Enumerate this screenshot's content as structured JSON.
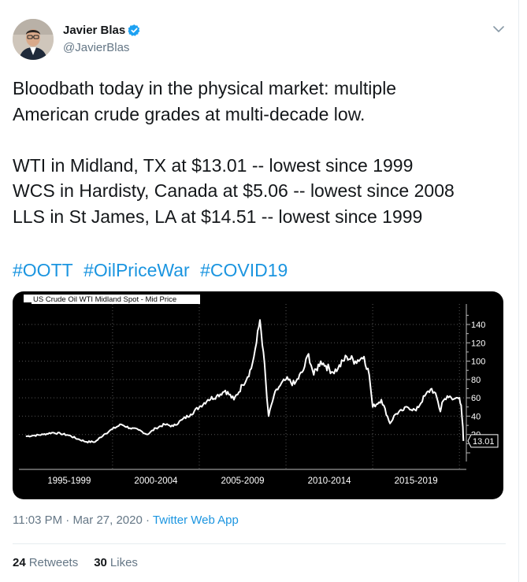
{
  "author": {
    "name": "Javier Blas",
    "handle": "@JavierBlas",
    "verified": true
  },
  "tweet": {
    "lines_a": [
      "Bloodbath today in the physical market: multiple",
      "American crude grades at multi-decade low."
    ],
    "lines_b": [
      "WTI in Midland, TX at $13.01 -- lowest since 1999",
      "WCS in Hardisty, Canada at $5.06 -- lowest since 2008",
      "LLS in St James, LA at $14.51 -- lowest since 1999"
    ],
    "hashtags": [
      "#OOTT",
      "#OilPriceWar",
      "#COVID19"
    ]
  },
  "meta": {
    "time": "11:03 PM",
    "date": "Mar 27, 2020",
    "separator": "·",
    "source": "Twitter Web App"
  },
  "stats": {
    "retweets_count": "24",
    "retweets_label": "Retweets",
    "likes_count": "30",
    "likes_label": "Likes"
  },
  "chart_data": {
    "type": "line",
    "legend": "US Crude Oil WTI Midland Spot - Mid Price",
    "x_labels": [
      "1995-1999",
      "2000-2004",
      "2005-2009",
      "2010-2014",
      "2015-2019"
    ],
    "y_ticks": [
      "140",
      "120",
      "100",
      "80",
      "60",
      "40",
      "20"
    ],
    "ylim": [
      0,
      150
    ],
    "last_value_label": "13.01",
    "background": "#000000",
    "line_color": "#ffffff",
    "grid": true,
    "series": [
      {
        "x": [
          1995.0,
          1995.5,
          1996.0,
          1996.5,
          1997.0,
          1997.5,
          1998.0,
          1998.5,
          1999.0,
          1999.5,
          2000.0,
          2000.5,
          2001.0,
          2001.5,
          2002.0,
          2002.5,
          2003.0,
          2003.5,
          2004.0,
          2004.5,
          2005.0,
          2005.5,
          2006.0,
          2006.5,
          2007.0,
          2007.5,
          2008.0,
          2008.3,
          2008.5,
          2008.7,
          2008.9,
          2009.0,
          2009.3,
          2009.6,
          2010.0,
          2010.5,
          2011.0,
          2011.3,
          2011.6,
          2012.0,
          2012.3,
          2012.7,
          2013.0,
          2013.5,
          2014.0,
          2014.5,
          2014.8,
          2015.0,
          2015.5,
          2016.0,
          2016.3,
          2016.7,
          2017.0,
          2017.5,
          2018.0,
          2018.4,
          2018.7,
          2018.9,
          2019.0,
          2019.3,
          2019.6,
          2019.9,
          2020.0,
          2020.1,
          2020.2,
          2020.23
        ],
        "y": [
          18,
          19,
          20,
          22,
          21,
          19,
          15,
          12,
          12,
          20,
          26,
          31,
          27,
          25,
          20,
          27,
          31,
          29,
          36,
          42,
          50,
          58,
          62,
          68,
          58,
          74,
          92,
          120,
          145,
          110,
          60,
          40,
          62,
          72,
          80,
          75,
          90,
          108,
          85,
          100,
          95,
          88,
          92,
          105,
          100,
          105,
          85,
          50,
          58,
          32,
          42,
          46,
          50,
          46,
          62,
          70,
          60,
          45,
          55,
          62,
          58,
          60,
          60,
          52,
          28,
          13.01
        ]
      }
    ]
  }
}
